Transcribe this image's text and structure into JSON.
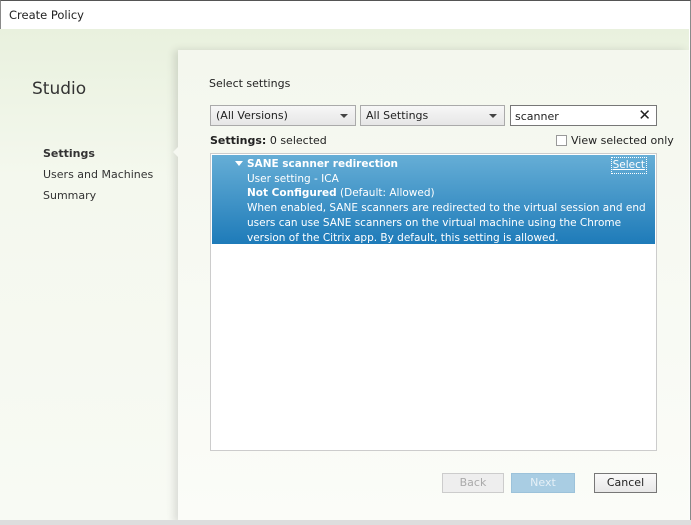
{
  "window": {
    "title": "Create Policy"
  },
  "sidebar": {
    "brand": "Studio",
    "items": [
      {
        "label": "Settings",
        "active": true
      },
      {
        "label": "Users and Machines"
      },
      {
        "label": "Summary"
      }
    ]
  },
  "main": {
    "heading": "Select settings",
    "version_filter": "(All Versions)",
    "settings_filter": "All Settings",
    "search_value": "scanner",
    "clear_icon": "✕",
    "count_label": "Settings:",
    "count_value": "0 selected",
    "view_selected_only": "View selected only",
    "results": [
      {
        "name": "SANE scanner redirection",
        "type": "User setting - ICA",
        "state": "Not Configured",
        "default": "(Default: Allowed)",
        "description": "When enabled, SANE scanners are redirected to the virtual session and end users can use SANE scanners on the virtual machine using the Chrome version of the Citrix app. By default, this setting is allowed.",
        "select_label": "Select"
      }
    ]
  },
  "footer": {
    "back": "Back",
    "next": "Next",
    "cancel": "Cancel"
  },
  "colors": {
    "selected_row": "#1e7bb9",
    "accent": "#66aed6"
  }
}
